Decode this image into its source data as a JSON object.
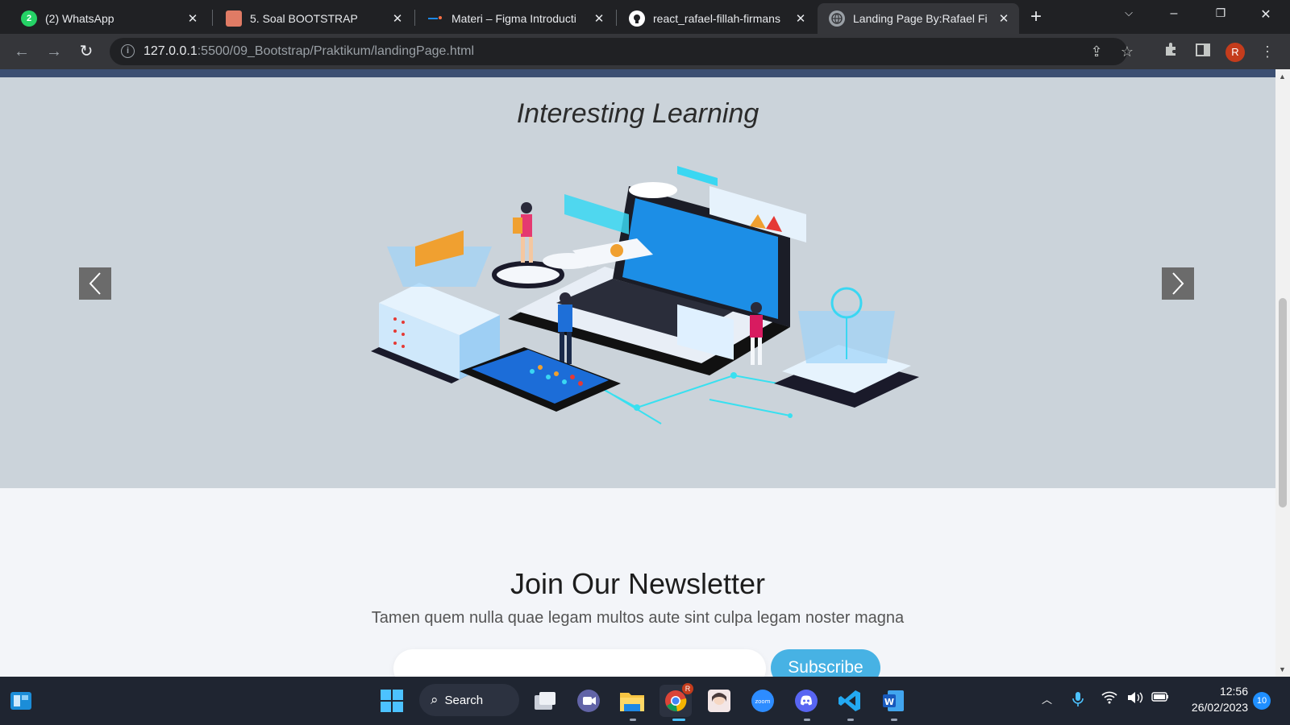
{
  "browser": {
    "tabs": [
      {
        "title": "(2) WhatsApp",
        "favicon": "whatsapp-icon",
        "badge": "2",
        "color": "#25d366"
      },
      {
        "title": "5. Soal BOOTSTRAP",
        "favicon": "document-icon",
        "color": "#e07b65"
      },
      {
        "title": "Materi – Figma Introducti",
        "favicon": "figma-icon",
        "color": "#a259ff"
      },
      {
        "title": "react_rafael-fillah-firmans",
        "favicon": "github-icon",
        "color": "#ffffff"
      },
      {
        "title": "Landing Page By:Rafael Fi",
        "favicon": "globe-icon",
        "color": "#9aa0a6",
        "active": true
      }
    ],
    "address": {
      "host": "127.0.0.1",
      "path": ":5500/09_Bootstrap/Praktikum/landingPage.html"
    },
    "profile_initial": "R"
  },
  "page": {
    "carousel": {
      "title": "Interesting Learning",
      "prev_label": "Previous",
      "next_label": "Next"
    },
    "newsletter": {
      "title": "Join Our Newsletter",
      "subtitle": "Tamen quem nulla quae legam multos aute sint culpa legam noster magna",
      "email_placeholder": "",
      "subscribe_label": "Subscribe",
      "accent": "#47b2e4"
    }
  },
  "taskbar": {
    "search_label": "Search",
    "time": "12:56",
    "date": "26/02/2023",
    "notification_count": "10",
    "chrome_badge": "R"
  }
}
